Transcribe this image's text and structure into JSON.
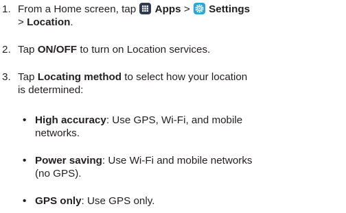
{
  "steps": [
    {
      "number": "1.",
      "prefix": "From a Home screen, tap ",
      "apps_label": "Apps",
      "sep1": " > ",
      "settings_label": "Settings",
      "line2_prefix": "> ",
      "location_label": "Location",
      "line2_suffix": "."
    },
    {
      "number": "2.",
      "prefix": "Tap ",
      "bold": "ON/OFF",
      "suffix": " to turn on Location services."
    },
    {
      "number": "3.",
      "prefix": "Tap ",
      "bold": "Locating method",
      "suffix_line1": " to select how your location",
      "suffix_line2": "is determined:"
    }
  ],
  "bullets": [
    {
      "dot": "•",
      "bold": "High accuracy",
      "text_line1": ": Use GPS, Wi-Fi, and mobile",
      "text_line2": "networks."
    },
    {
      "dot": "•",
      "bold": "Power saving",
      "text_line1": ": Use Wi-Fi and mobile networks",
      "text_line2": "(no GPS)."
    },
    {
      "dot": "•",
      "bold": "GPS only",
      "text_line1": ": Use GPS only."
    }
  ],
  "icons": {
    "apps": "apps-grid-icon",
    "settings": "settings-gear-icon"
  },
  "colors": {
    "text": "#231f20",
    "apps_icon_bg": "#2e3a52",
    "settings_icon_bg": "#27a9d8"
  }
}
